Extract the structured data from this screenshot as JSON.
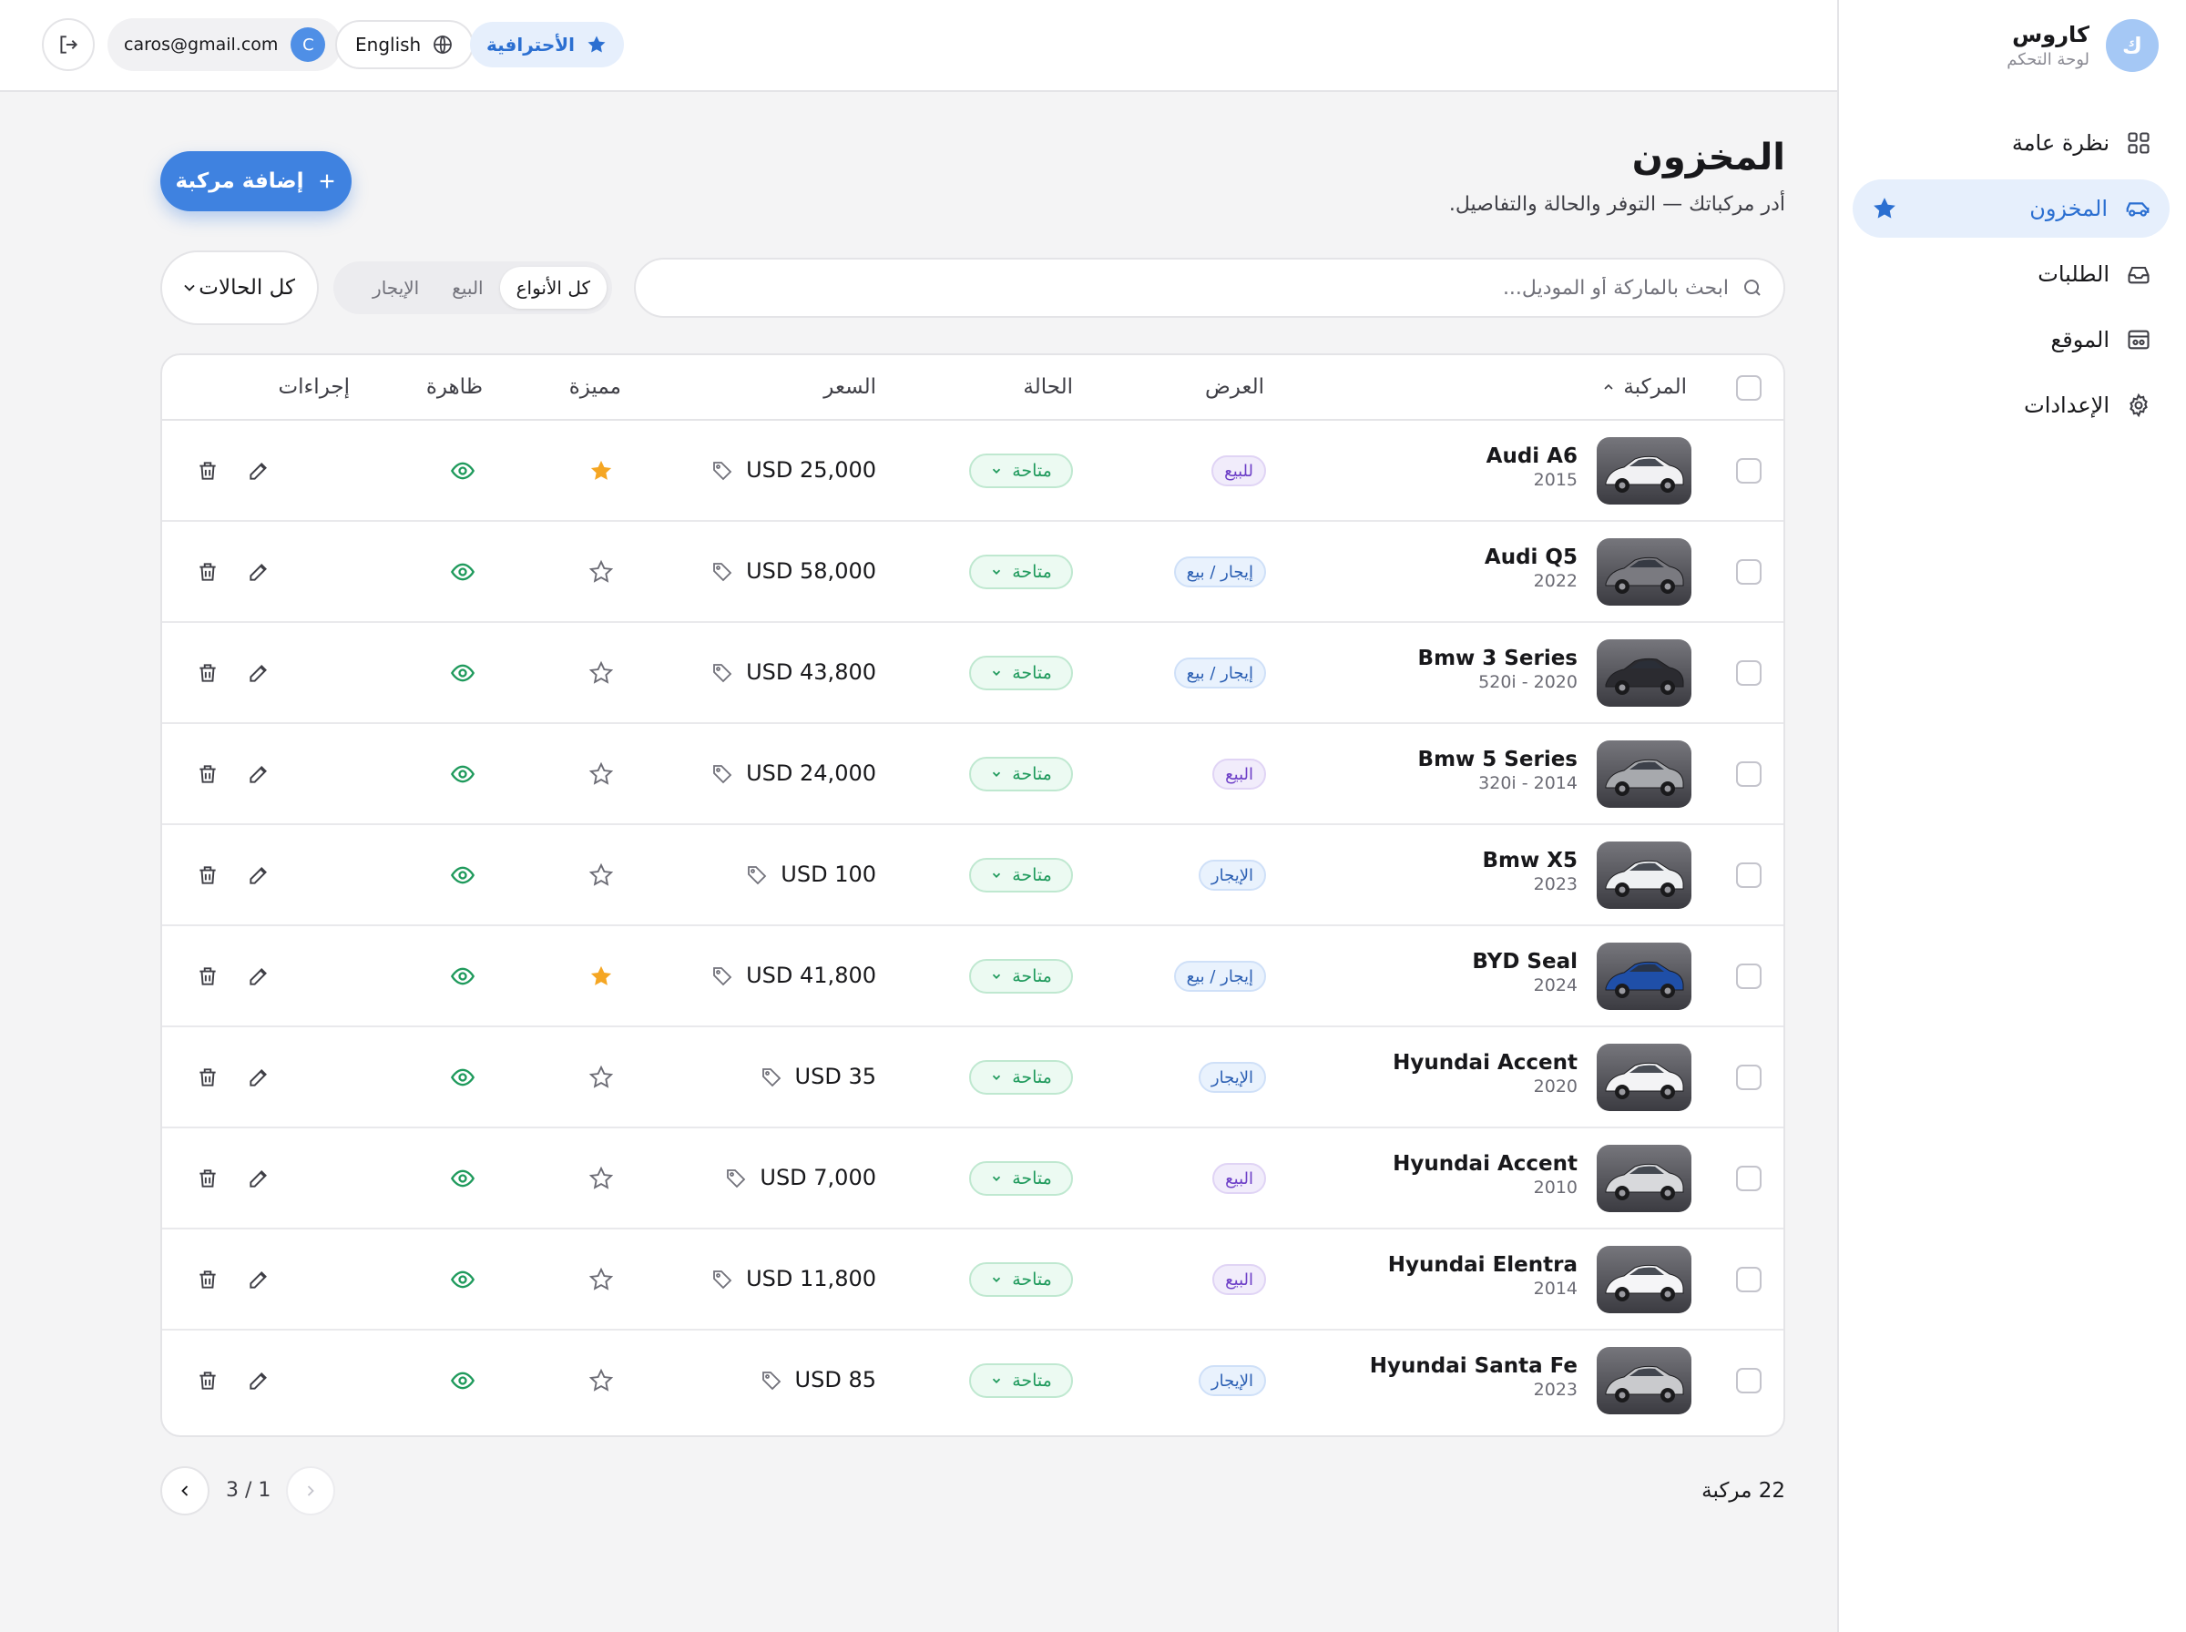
{
  "brand": {
    "initial": "ك",
    "name": "كاروس",
    "subtitle": "لوحة التحكم"
  },
  "sidebar": {
    "items": [
      {
        "label": "نظرة عامة",
        "icon": "grid-icon",
        "active": false
      },
      {
        "label": "المخزون",
        "icon": "car-icon",
        "active": true
      },
      {
        "label": "الطلبات",
        "icon": "inbox-icon",
        "active": false
      },
      {
        "label": "الموقع",
        "icon": "storefront-icon",
        "active": false
      },
      {
        "label": "الإعدادات",
        "icon": "gear-icon",
        "active": false
      }
    ]
  },
  "topbar": {
    "user_email": "caros@gmail.com",
    "user_initial": "C",
    "language": "English",
    "plan": "الأحترافية"
  },
  "page": {
    "title": "المخزون",
    "subtitle": "أدر مركباتك — التوفر والحالة والتفاصيل.",
    "add_button": "إضافة مركبة"
  },
  "filters": {
    "search_placeholder": "ابحث بالماركة أو الموديل...",
    "type_options": [
      "كل الأنواع",
      "البيع",
      "الإيجار"
    ],
    "type_selected": "كل الأنواع",
    "status_selected": "كل الحالات"
  },
  "table": {
    "headers": {
      "vehicle": "المركبة",
      "offer": "العرض",
      "status": "الحالة",
      "price": "السعر",
      "featured": "مميزة",
      "visible": "ظاهرة",
      "actions": "إجراءات"
    },
    "rows": [
      {
        "name": "Audi A6",
        "sub": "2015",
        "offer": "للبيع",
        "offer_type": "sale",
        "status": "متاحة",
        "price": "USD 25,000",
        "featured": true,
        "visible": true,
        "color": "#f1f1f3"
      },
      {
        "name": "Audi Q5",
        "sub": "2022",
        "offer": "إيجار / بيع",
        "offer_type": "rent",
        "status": "متاحة",
        "price": "USD 58,000",
        "featured": false,
        "visible": true,
        "color": "#7a7a80"
      },
      {
        "name": "Bmw 3 Series",
        "sub": "520i - 2020",
        "offer": "إيجار / بيع",
        "offer_type": "rent",
        "status": "متاحة",
        "price": "USD 43,800",
        "featured": false,
        "visible": true,
        "color": "#2b2b30"
      },
      {
        "name": "Bmw 5 Series",
        "sub": "320i - 2014",
        "offer": "البيع",
        "offer_type": "sale",
        "status": "متاحة",
        "price": "USD 24,000",
        "featured": false,
        "visible": true,
        "color": "#a7a9ad"
      },
      {
        "name": "Bmw X5",
        "sub": "2023",
        "offer": "الإيجار",
        "offer_type": "rent",
        "status": "متاحة",
        "price": "USD 100",
        "featured": false,
        "visible": true,
        "color": "#eef0f2"
      },
      {
        "name": "BYD Seal",
        "sub": "2024",
        "offer": "إيجار / بيع",
        "offer_type": "rent",
        "status": "متاحة",
        "price": "USD 41,800",
        "featured": true,
        "visible": true,
        "color": "#1f4fa8"
      },
      {
        "name": "Hyundai Accent",
        "sub": "2020",
        "offer": "الإيجار",
        "offer_type": "rent",
        "status": "متاحة",
        "price": "USD 35",
        "featured": false,
        "visible": true,
        "color": "#f3f3f5"
      },
      {
        "name": "Hyundai Accent",
        "sub": "2010",
        "offer": "البيع",
        "offer_type": "sale",
        "status": "متاحة",
        "price": "USD 7,000",
        "featured": false,
        "visible": true,
        "color": "#d8d9dc"
      },
      {
        "name": "Hyundai Elentra",
        "sub": "2014",
        "offer": "البيع",
        "offer_type": "sale",
        "status": "متاحة",
        "price": "USD 11,800",
        "featured": false,
        "visible": true,
        "color": "#f5f5f7"
      },
      {
        "name": "Hyundai Santa Fe",
        "sub": "2023",
        "offer": "الإيجار",
        "offer_type": "rent",
        "status": "متاحة",
        "price": "USD 85",
        "featured": false,
        "visible": true,
        "color": "#c9cacd"
      }
    ]
  },
  "footer": {
    "page_indicator": "3 / 1",
    "total": "22 مركبة"
  },
  "colors": {
    "accent": "#3f82e0",
    "status_green": "#1f9a5c",
    "star_gold": "#f5a623"
  }
}
